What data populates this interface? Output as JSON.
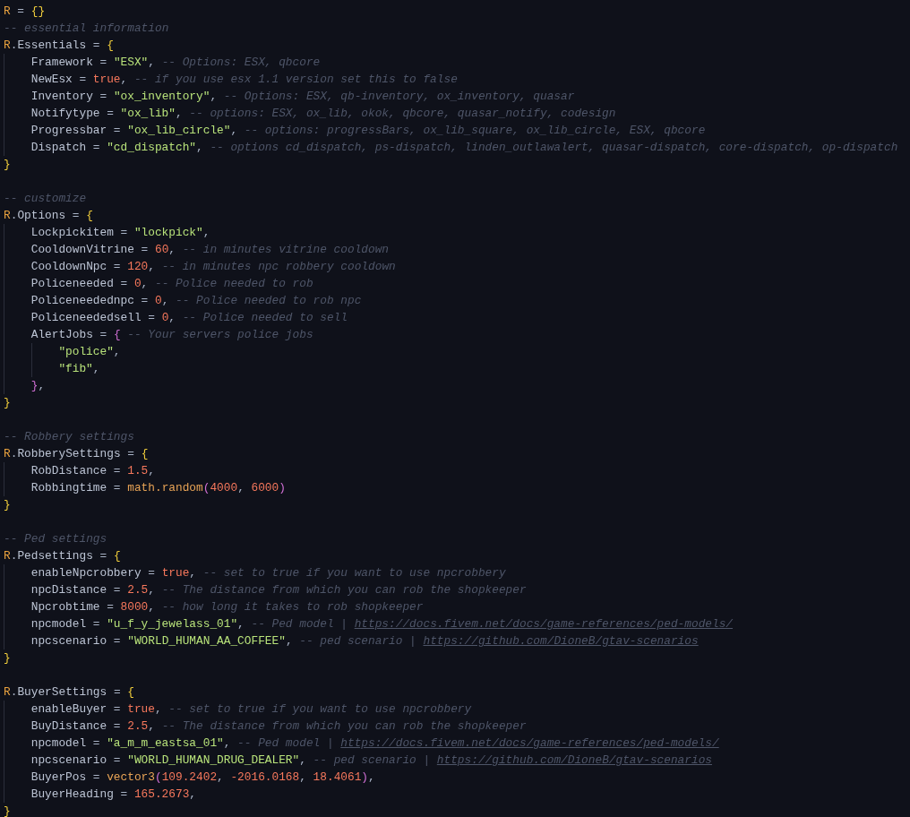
{
  "editor": {
    "lines": [
      {
        "kind": "code",
        "tokens": [
          {
            "kind": "global",
            "text": "R"
          },
          {
            "kind": "punct",
            "text": " = "
          },
          {
            "kind": "bracket",
            "text": "{}"
          }
        ]
      },
      {
        "kind": "code",
        "tokens": [
          {
            "kind": "comment",
            "text": "-- essential information"
          }
        ]
      },
      {
        "kind": "code",
        "tokens": [
          {
            "kind": "global",
            "text": "R"
          },
          {
            "kind": "punct",
            "text": "."
          },
          {
            "kind": "key",
            "text": "Essentials"
          },
          {
            "kind": "punct",
            "text": " = "
          },
          {
            "kind": "bracket",
            "text": "{"
          }
        ],
        "children": [
          {
            "kind": "code",
            "tokens": [
              {
                "kind": "key",
                "text": "Framework"
              },
              {
                "kind": "punct",
                "text": " = "
              },
              {
                "kind": "string",
                "text": "\"ESX\""
              },
              {
                "kind": "punct",
                "text": ", "
              },
              {
                "kind": "comment",
                "text": "-- Options: ESX, qbcore"
              }
            ]
          },
          {
            "kind": "code",
            "tokens": [
              {
                "kind": "key",
                "text": "NewEsx"
              },
              {
                "kind": "punct",
                "text": " = "
              },
              {
                "kind": "boolean",
                "text": "true"
              },
              {
                "kind": "punct",
                "text": ", "
              },
              {
                "kind": "comment",
                "text": "-- if you use esx 1.1 version set this to false"
              }
            ]
          },
          {
            "kind": "code",
            "tokens": [
              {
                "kind": "key",
                "text": "Inventory"
              },
              {
                "kind": "punct",
                "text": " = "
              },
              {
                "kind": "string",
                "text": "\"ox_inventory\""
              },
              {
                "kind": "punct",
                "text": ", "
              },
              {
                "kind": "comment",
                "text": "-- Options: ESX, qb-inventory, ox_inventory, quasar"
              }
            ]
          },
          {
            "kind": "code",
            "tokens": [
              {
                "kind": "key",
                "text": "Notifytype"
              },
              {
                "kind": "punct",
                "text": " = "
              },
              {
                "kind": "string",
                "text": "\"ox_lib\""
              },
              {
                "kind": "punct",
                "text": ", "
              },
              {
                "kind": "comment",
                "text": "-- options: ESX, ox_lib, okok, qbcore, quasar_notify, codesign"
              }
            ]
          },
          {
            "kind": "code",
            "tokens": [
              {
                "kind": "key",
                "text": "Progressbar"
              },
              {
                "kind": "punct",
                "text": " = "
              },
              {
                "kind": "string",
                "text": "\"ox_lib_circle\""
              },
              {
                "kind": "punct",
                "text": ", "
              },
              {
                "kind": "comment",
                "text": "-- options: progressBars, ox_lib_square, ox_lib_circle, ESX, qbcore"
              }
            ]
          },
          {
            "kind": "code",
            "tokens": [
              {
                "kind": "key",
                "text": "Dispatch"
              },
              {
                "kind": "punct",
                "text": " = "
              },
              {
                "kind": "string",
                "text": "\"cd_dispatch\""
              },
              {
                "kind": "punct",
                "text": ", "
              },
              {
                "kind": "comment",
                "text": "-- options cd_dispatch, ps-dispatch, linden_outlawalert, quasar-dispatch, core-dispatch, op-dispatch"
              }
            ]
          }
        ]
      },
      {
        "kind": "code",
        "tokens": [
          {
            "kind": "bracket",
            "text": "}"
          }
        ]
      },
      {
        "kind": "blank"
      },
      {
        "kind": "code",
        "tokens": [
          {
            "kind": "comment",
            "text": "-- customize"
          }
        ]
      },
      {
        "kind": "code",
        "tokens": [
          {
            "kind": "global",
            "text": "R"
          },
          {
            "kind": "punct",
            "text": "."
          },
          {
            "kind": "key",
            "text": "Options"
          },
          {
            "kind": "punct",
            "text": " = "
          },
          {
            "kind": "bracket",
            "text": "{"
          }
        ],
        "children": [
          {
            "kind": "code",
            "tokens": [
              {
                "kind": "key",
                "text": "Lockpickitem"
              },
              {
                "kind": "punct",
                "text": " = "
              },
              {
                "kind": "string",
                "text": "\"lockpick\""
              },
              {
                "kind": "punct",
                "text": ","
              }
            ]
          },
          {
            "kind": "code",
            "tokens": [
              {
                "kind": "key",
                "text": "CooldownVitrine"
              },
              {
                "kind": "punct",
                "text": " = "
              },
              {
                "kind": "number",
                "text": "60"
              },
              {
                "kind": "punct",
                "text": ", "
              },
              {
                "kind": "comment",
                "text": "-- in minutes vitrine cooldown"
              }
            ]
          },
          {
            "kind": "code",
            "tokens": [
              {
                "kind": "key",
                "text": "CooldownNpc"
              },
              {
                "kind": "punct",
                "text": " = "
              },
              {
                "kind": "number",
                "text": "120"
              },
              {
                "kind": "punct",
                "text": ", "
              },
              {
                "kind": "comment",
                "text": "-- in minutes npc robbery cooldown"
              }
            ]
          },
          {
            "kind": "code",
            "tokens": [
              {
                "kind": "key",
                "text": "Policeneeded"
              },
              {
                "kind": "punct",
                "text": " = "
              },
              {
                "kind": "number",
                "text": "0"
              },
              {
                "kind": "punct",
                "text": ", "
              },
              {
                "kind": "comment",
                "text": "-- Police needed to rob"
              }
            ]
          },
          {
            "kind": "code",
            "tokens": [
              {
                "kind": "key",
                "text": "Policeneedednpc"
              },
              {
                "kind": "punct",
                "text": " = "
              },
              {
                "kind": "number",
                "text": "0"
              },
              {
                "kind": "punct",
                "text": ", "
              },
              {
                "kind": "comment",
                "text": "-- Police needed to rob npc"
              }
            ]
          },
          {
            "kind": "code",
            "tokens": [
              {
                "kind": "key",
                "text": "Policeneededsell"
              },
              {
                "kind": "punct",
                "text": " = "
              },
              {
                "kind": "number",
                "text": "0"
              },
              {
                "kind": "punct",
                "text": ", "
              },
              {
                "kind": "comment",
                "text": "-- Police needed to sell"
              }
            ]
          },
          {
            "kind": "code",
            "tokens": [
              {
                "kind": "key",
                "text": "AlertJobs"
              },
              {
                "kind": "punct",
                "text": " = "
              },
              {
                "kind": "bracket2",
                "text": "{"
              },
              {
                "kind": "comment",
                "text": "-- Your servers police jobs"
              }
            ],
            "children": [
              {
                "kind": "code",
                "tokens": [
                  {
                    "kind": "string",
                    "text": "\"police\""
                  },
                  {
                    "kind": "punct",
                    "text": ","
                  }
                ]
              },
              {
                "kind": "code",
                "tokens": [
                  {
                    "kind": "string",
                    "text": "\"fib\""
                  },
                  {
                    "kind": "punct",
                    "text": ","
                  }
                ]
              }
            ]
          },
          {
            "kind": "code",
            "tokens": [
              {
                "kind": "bracket2",
                "text": "}"
              },
              {
                "kind": "punct",
                "text": ","
              }
            ]
          }
        ]
      },
      {
        "kind": "code",
        "tokens": [
          {
            "kind": "bracket",
            "text": "}"
          }
        ]
      },
      {
        "kind": "blank"
      },
      {
        "kind": "code",
        "tokens": [
          {
            "kind": "comment",
            "text": "-- Robbery settings"
          }
        ]
      },
      {
        "kind": "code",
        "tokens": [
          {
            "kind": "global",
            "text": "R"
          },
          {
            "kind": "punct",
            "text": "."
          },
          {
            "kind": "key",
            "text": "RobberySettings"
          },
          {
            "kind": "punct",
            "text": " = "
          },
          {
            "kind": "bracket",
            "text": "{"
          }
        ],
        "children": [
          {
            "kind": "code",
            "tokens": [
              {
                "kind": "key",
                "text": "RobDistance"
              },
              {
                "kind": "punct",
                "text": " = "
              },
              {
                "kind": "number",
                "text": "1.5"
              },
              {
                "kind": "punct",
                "text": ","
              }
            ]
          },
          {
            "kind": "code",
            "tokens": [
              {
                "kind": "key",
                "text": "Robbingtime"
              },
              {
                "kind": "punct",
                "text": " = "
              },
              {
                "kind": "function",
                "text": "math.random"
              },
              {
                "kind": "bracket2",
                "text": "("
              },
              {
                "kind": "number",
                "text": "4000"
              },
              {
                "kind": "punct",
                "text": ", "
              },
              {
                "kind": "number",
                "text": "6000"
              },
              {
                "kind": "bracket2",
                "text": ")"
              }
            ]
          }
        ]
      },
      {
        "kind": "code",
        "tokens": [
          {
            "kind": "bracket",
            "text": "}"
          }
        ]
      },
      {
        "kind": "blank"
      },
      {
        "kind": "code",
        "tokens": [
          {
            "kind": "comment",
            "text": "-- Ped settings"
          }
        ]
      },
      {
        "kind": "code",
        "tokens": [
          {
            "kind": "global",
            "text": "R"
          },
          {
            "kind": "punct",
            "text": "."
          },
          {
            "kind": "key",
            "text": "Pedsettings"
          },
          {
            "kind": "punct",
            "text": " = "
          },
          {
            "kind": "bracket",
            "text": "{"
          }
        ],
        "children": [
          {
            "kind": "code",
            "tokens": [
              {
                "kind": "key",
                "text": "enableNpcrobbery"
              },
              {
                "kind": "punct",
                "text": " = "
              },
              {
                "kind": "boolean",
                "text": "true"
              },
              {
                "kind": "punct",
                "text": ", "
              },
              {
                "kind": "comment",
                "text": "-- set to true if you want to use npcrobbery"
              }
            ]
          },
          {
            "kind": "code",
            "tokens": [
              {
                "kind": "key",
                "text": "npcDistance"
              },
              {
                "kind": "punct",
                "text": " = "
              },
              {
                "kind": "number",
                "text": "2.5"
              },
              {
                "kind": "punct",
                "text": ", "
              },
              {
                "kind": "comment",
                "text": "-- The distance from which you can rob the shopkeeper"
              }
            ]
          },
          {
            "kind": "code",
            "tokens": [
              {
                "kind": "key",
                "text": "Npcrobtime"
              },
              {
                "kind": "punct",
                "text": " = "
              },
              {
                "kind": "number",
                "text": "8000"
              },
              {
                "kind": "punct",
                "text": ", "
              },
              {
                "kind": "comment",
                "text": "-- how long it takes to rob shopkeeper"
              }
            ]
          },
          {
            "kind": "code",
            "tokens": [
              {
                "kind": "key",
                "text": "npcmodel"
              },
              {
                "kind": "punct",
                "text": " = "
              },
              {
                "kind": "string",
                "text": "\"u_f_y_jewelass_01\""
              },
              {
                "kind": "punct",
                "text": ", "
              },
              {
                "kind": "comment",
                "text": "-- Ped model |"
              },
              {
                "kind": "link",
                "text": "https://docs.fivem.net/docs/game-references/ped-models/"
              }
            ]
          },
          {
            "kind": "code",
            "tokens": [
              {
                "kind": "key",
                "text": "npcscenario"
              },
              {
                "kind": "punct",
                "text": " = "
              },
              {
                "kind": "string",
                "text": "\"WORLD_HUMAN_AA_COFFEE\""
              },
              {
                "kind": "punct",
                "text": ", "
              },
              {
                "kind": "comment",
                "text": "-- ped scenario |"
              },
              {
                "kind": "link",
                "text": "https://github.com/DioneB/gtav-scenarios"
              }
            ]
          }
        ]
      },
      {
        "kind": "code",
        "tokens": [
          {
            "kind": "bracket",
            "text": "}"
          }
        ]
      },
      {
        "kind": "blank"
      },
      {
        "kind": "code",
        "tokens": [
          {
            "kind": "global",
            "text": "R"
          },
          {
            "kind": "punct",
            "text": "."
          },
          {
            "kind": "key",
            "text": "BuyerSettings"
          },
          {
            "kind": "punct",
            "text": " = "
          },
          {
            "kind": "bracket",
            "text": "{"
          }
        ],
        "children": [
          {
            "kind": "code",
            "tokens": [
              {
                "kind": "key",
                "text": "enableBuyer"
              },
              {
                "kind": "punct",
                "text": " = "
              },
              {
                "kind": "boolean",
                "text": "true"
              },
              {
                "kind": "punct",
                "text": ", "
              },
              {
                "kind": "comment",
                "text": "-- set to true if you want to use npcrobbery"
              }
            ]
          },
          {
            "kind": "code",
            "tokens": [
              {
                "kind": "key",
                "text": "BuyDistance"
              },
              {
                "kind": "punct",
                "text": " = "
              },
              {
                "kind": "number",
                "text": "2.5"
              },
              {
                "kind": "punct",
                "text": ", "
              },
              {
                "kind": "comment",
                "text": "-- The distance from which you can rob the shopkeeper"
              }
            ]
          },
          {
            "kind": "code",
            "tokens": [
              {
                "kind": "key",
                "text": "npcmodel"
              },
              {
                "kind": "punct",
                "text": " = "
              },
              {
                "kind": "string",
                "text": "\"a_m_m_eastsa_01\""
              },
              {
                "kind": "punct",
                "text": ", "
              },
              {
                "kind": "comment",
                "text": "-- Ped model |"
              },
              {
                "kind": "link",
                "text": "https://docs.fivem.net/docs/game-references/ped-models/"
              }
            ]
          },
          {
            "kind": "code",
            "tokens": [
              {
                "kind": "key",
                "text": "npcscenario"
              },
              {
                "kind": "punct",
                "text": " = "
              },
              {
                "kind": "string",
                "text": "\"WORLD_HUMAN_DRUG_DEALER\""
              },
              {
                "kind": "punct",
                "text": ", "
              },
              {
                "kind": "comment",
                "text": "-- ped scenario |"
              },
              {
                "kind": "link",
                "text": "https://github.com/DioneB/gtav-scenarios"
              }
            ]
          },
          {
            "kind": "code",
            "tokens": [
              {
                "kind": "key",
                "text": "BuyerPos"
              },
              {
                "kind": "punct",
                "text": " = "
              },
              {
                "kind": "function",
                "text": "vector3"
              },
              {
                "kind": "bracket2",
                "text": "("
              },
              {
                "kind": "number",
                "text": "109.2402"
              },
              {
                "kind": "punct",
                "text": ", "
              },
              {
                "kind": "number",
                "text": "-2016.0168"
              },
              {
                "kind": "punct",
                "text": ", "
              },
              {
                "kind": "number",
                "text": "18.4061"
              },
              {
                "kind": "bracket2",
                "text": ")"
              },
              {
                "kind": "punct",
                "text": ","
              }
            ]
          },
          {
            "kind": "code",
            "tokens": [
              {
                "kind": "key",
                "text": "BuyerHeading"
              },
              {
                "kind": "punct",
                "text": " = "
              },
              {
                "kind": "number",
                "text": "165.2673"
              },
              {
                "kind": "punct",
                "text": ","
              }
            ]
          }
        ]
      },
      {
        "kind": "code",
        "tokens": [
          {
            "kind": "bracket",
            "text": "}"
          }
        ]
      }
    ]
  }
}
